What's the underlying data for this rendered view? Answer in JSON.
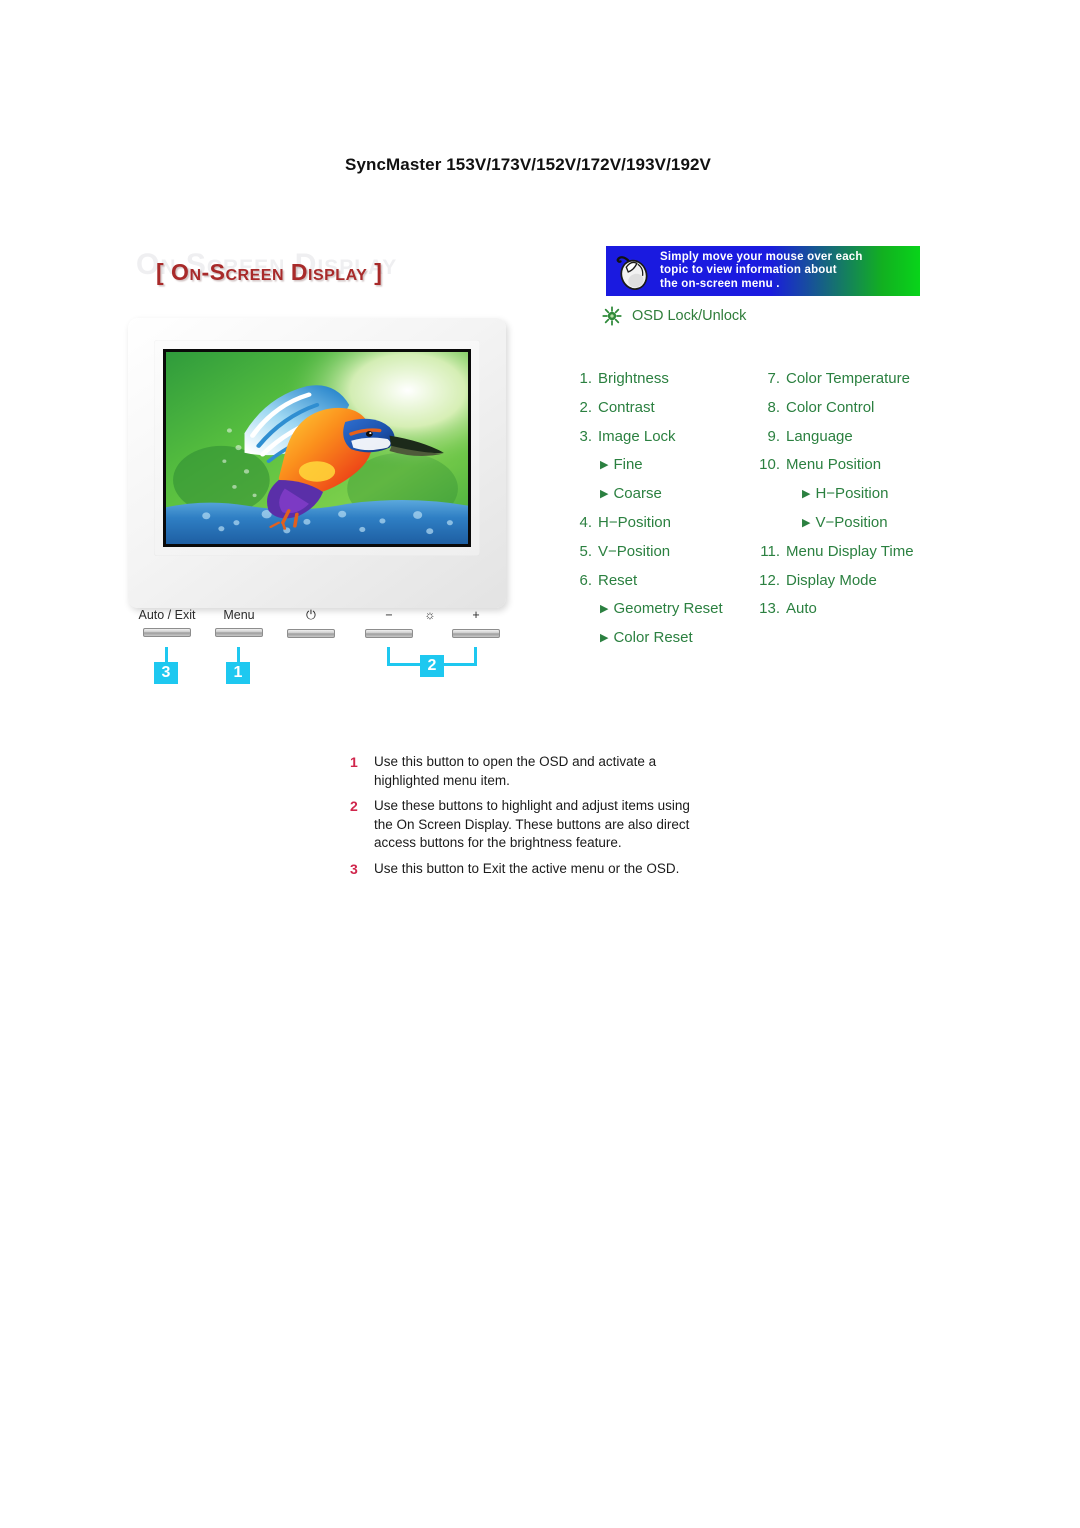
{
  "page": {
    "title": "SyncMaster 153V/173V/152V/172V/193V/192V"
  },
  "heading": {
    "watermark": "On Screen Display",
    "text": "[ On-Screen Display ]"
  },
  "hint_banner": {
    "icon": "mouse-icon",
    "text": "Simply move your mouse over each\ntopic to view information about\nthe on-screen menu .",
    "gradient_start": "#1a1ae0",
    "gradient_end": "#08d41a"
  },
  "osd_lock": {
    "icon": "sunburst-icon",
    "label": "OSD Lock/Unlock",
    "color": "#2f7d3a"
  },
  "monitor": {
    "screen_image": "kingfisher-bird-photo",
    "bezel_color": "#f2f2f2",
    "controls": [
      {
        "label": "Auto / Exit",
        "kind": "text",
        "name": "auto-exit"
      },
      {
        "label": "Menu",
        "kind": "text",
        "name": "menu"
      },
      {
        "label": "⏻",
        "kind": "icon",
        "name": "power"
      },
      {
        "label": "−",
        "kind": "icon",
        "name": "minus"
      },
      {
        "label": "☼",
        "kind": "icon",
        "name": "brightness"
      },
      {
        "label": "+",
        "kind": "icon",
        "name": "plus"
      }
    ],
    "callouts": [
      {
        "id": "3",
        "target": "auto-exit"
      },
      {
        "id": "1",
        "target": "menu"
      },
      {
        "id": "2",
        "target": "minus-and-plus"
      }
    ],
    "callout_color": "#1ec8f0"
  },
  "menu": {
    "color": "#2b8040",
    "left_column": [
      {
        "num": "1.",
        "label": "Brightness",
        "sub": false
      },
      {
        "num": "2.",
        "label": "Contrast",
        "sub": false
      },
      {
        "num": "3.",
        "label": "Image Lock",
        "sub": false
      },
      {
        "num": "",
        "label": "Fine",
        "sub": true
      },
      {
        "num": "",
        "label": "Coarse",
        "sub": true
      },
      {
        "num": "4.",
        "label": "H−Position",
        "sub": false
      },
      {
        "num": "5.",
        "label": "V−Position",
        "sub": false
      },
      {
        "num": "6.",
        "label": "Reset",
        "sub": false
      },
      {
        "num": "",
        "label": "Geometry Reset",
        "sub": true
      },
      {
        "num": "",
        "label": "Color Reset",
        "sub": true
      }
    ],
    "right_column": [
      {
        "num": "7.",
        "label": "Color Temperature",
        "sub": false
      },
      {
        "num": "8.",
        "label": "Color Control",
        "sub": false
      },
      {
        "num": "9.",
        "label": "Language",
        "sub": false
      },
      {
        "num": "10.",
        "label": "Menu Position",
        "sub": false
      },
      {
        "num": "",
        "label": "H−Position",
        "sub": true
      },
      {
        "num": "",
        "label": "V−Position",
        "sub": true
      },
      {
        "num": "11.",
        "label": "Menu Display Time",
        "sub": false
      },
      {
        "num": "12.",
        "label": "Display Mode",
        "sub": false
      },
      {
        "num": "13.",
        "label": "Auto",
        "sub": false
      }
    ]
  },
  "legend": {
    "number_color": "#d0264c",
    "rows": [
      {
        "num": "1",
        "text": "Use this button to open the OSD and activate a\nhighlighted menu item."
      },
      {
        "num": "2",
        "text": "Use these buttons to highlight and adjust items using\nthe On Screen Display. These buttons are also direct\naccess buttons for the brightness feature."
      },
      {
        "num": "3",
        "text": "Use this button to Exit the active menu or the OSD."
      }
    ]
  }
}
